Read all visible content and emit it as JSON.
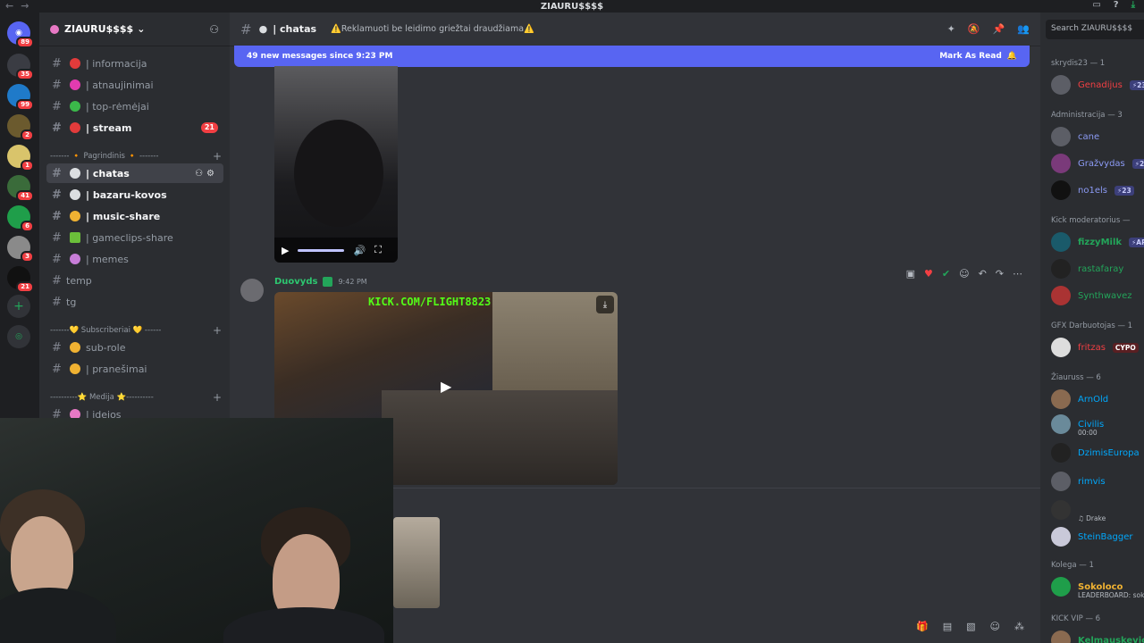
{
  "titlebar": {
    "server_name": "ZIAURU$$$$"
  },
  "guilds": {
    "badges": [
      "89",
      "35",
      "99",
      "2",
      "1",
      "41",
      "6",
      "3",
      "21"
    ]
  },
  "server": {
    "name": "ZIAURU$$$$"
  },
  "channels": [
    {
      "label": "| informacija",
      "unread": false
    },
    {
      "label": "| atnaujinimai",
      "unread": false
    },
    {
      "label": "| top-rėmėjai",
      "unread": false
    },
    {
      "label": "| stream",
      "unread": true,
      "mentions": "21"
    },
    {
      "label": "| chatas",
      "active": true
    },
    {
      "label": "| bazaru-kovos",
      "unread": true
    },
    {
      "label": "| music-share",
      "unread": true
    },
    {
      "label": "| gameclips-share",
      "unread": false
    },
    {
      "label": "| memes",
      "unread": false
    },
    {
      "label": "temp",
      "unread": false
    },
    {
      "label": "tg",
      "unread": false
    },
    {
      "label": "sub-role",
      "unread": false
    },
    {
      "label": "| pranešimai",
      "unread": false
    },
    {
      "label": "| idejos",
      "unread": false
    }
  ],
  "categories": {
    "pagrindinis": "------- 🔸 Pagrindinis 🔸 -------",
    "subscriberiai": "-------💛 Subscriberiai 💛 ------",
    "medija": "----------⭐ Medija ⭐----------"
  },
  "chat": {
    "channel_name": "| chatas",
    "topic": "⚠️Reklamuoti be leidimo griežtai draudžiama⚠️",
    "new_messages_text": "49 new messages since 9:23 PM",
    "mark_as_read": "Mark As Read",
    "message": {
      "author": "Duovyds",
      "timestamp": "9:42 PM",
      "overlay_text": "KICK.COM/FLIGHT8823"
    }
  },
  "members": {
    "search_placeholder": "Search ZIAURU$$$$",
    "groups": [
      {
        "title": "skrydis23 — 1",
        "members": [
          {
            "name": "Genadijus",
            "tag": "⚡23",
            "color": "#f23f43"
          }
        ]
      },
      {
        "title": "Administracija — 3",
        "members": [
          {
            "name": "cane",
            "color": "#5865f2"
          },
          {
            "name": "Gražvydas",
            "tag": "⚡23",
            "color": "#5865f2"
          },
          {
            "name": "no1els",
            "tag": "⚡23",
            "color": "#5865f2"
          }
        ]
      },
      {
        "title": "Kick moderatorius —",
        "members": [
          {
            "name": "fizzyMilk",
            "tag": "⚡ARC",
            "color": "#23a55a"
          },
          {
            "name": "rastafaray",
            "color": "#23a55a"
          },
          {
            "name": "Synthwavez",
            "color": "#23a55a"
          }
        ]
      },
      {
        "title": "GFX Darbuotojas — 1",
        "members": [
          {
            "name": "fritzas",
            "tag": "CYPO",
            "color": "#f23f43"
          }
        ]
      },
      {
        "title": "Žiauruss — 6",
        "members": [
          {
            "name": "ArnOld",
            "color": "#00a8fc"
          },
          {
            "name": "Civilis",
            "sub": "00:00",
            "color": "#00a8fc"
          },
          {
            "name": "DzimisEuropa",
            "color": "#00a8fc"
          },
          {
            "name": "rimvis",
            "color": "#00a8fc"
          },
          {
            "name": "",
            "sub": "♫ Drake",
            "color": "#00a8fc"
          },
          {
            "name": "SteinBagger",
            "color": "#00a8fc"
          }
        ]
      },
      {
        "title": "Kolega — 1",
        "members": [
          {
            "name": "Sokoloco",
            "sub": "LEADERBOARD: sok",
            "color": "#f0b232"
          }
        ]
      },
      {
        "title": "KICK VIP — 6",
        "members": [
          {
            "name": "Kelmauskevic",
            "color": "#23a55a"
          }
        ]
      }
    ]
  },
  "colors": {
    "accent": "#5865f2",
    "mention": "#f23f43",
    "online": "#23a55a"
  }
}
